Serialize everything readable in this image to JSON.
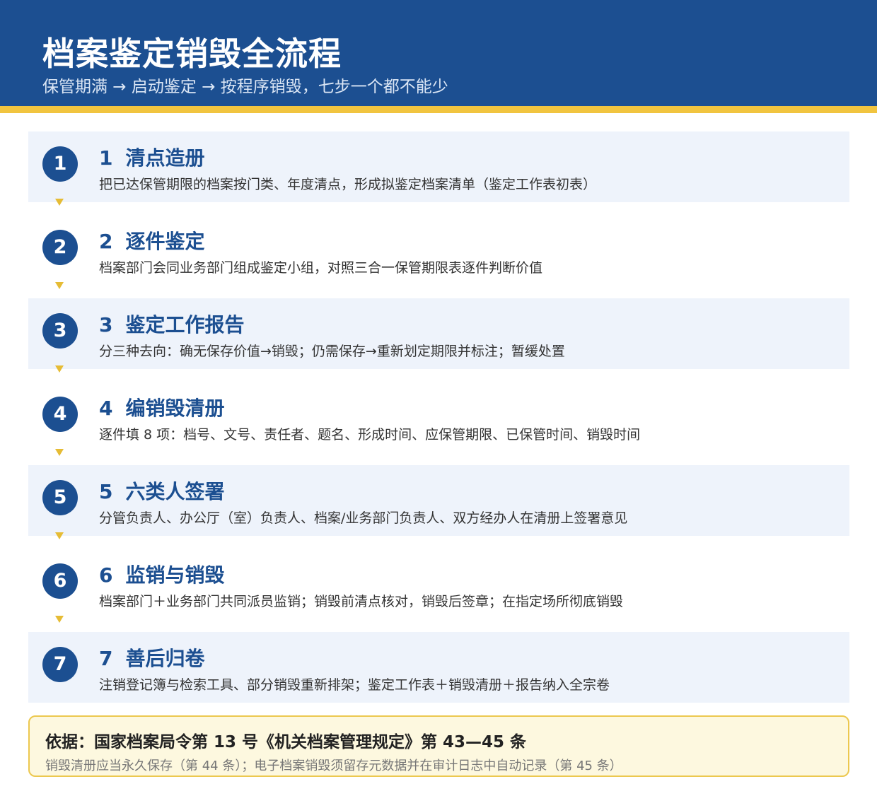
{
  "header": {
    "title": "档案鉴定销毁全流程",
    "subtitle": "保管期满 → 启动鉴定 → 按程序销毁，七步一个都不能少"
  },
  "steps": [
    {
      "num": "1",
      "title": "清点造册",
      "desc": "把已达保管期限的档案按门类、年度清点，形成拟鉴定档案清单（鉴定工作表初表）"
    },
    {
      "num": "2",
      "title": "逐件鉴定",
      "desc": "档案部门会同业务部门组成鉴定小组，对照三合一保管期限表逐件判断价值"
    },
    {
      "num": "3",
      "title": "鉴定工作报告",
      "desc": "分三种去向：确无保存价值→销毁；仍需保存→重新划定期限并标注；暂缓处置"
    },
    {
      "num": "4",
      "title": "编销毁清册",
      "desc": "逐件填 8 项：档号、文号、责任者、题名、形成时间、应保管期限、已保管时间、销毁时间"
    },
    {
      "num": "5",
      "title": "六类人签署",
      "desc": "分管负责人、办公厅（室）负责人、档案/业务部门负责人、双方经办人在清册上签署意见"
    },
    {
      "num": "6",
      "title": "监销与销毁",
      "desc": "档案部门＋业务部门共同派员监销；销毁前清点核对，销毁后签章；在指定场所彻底销毁"
    },
    {
      "num": "7",
      "title": "善后归卷",
      "desc": "注销登记簿与检索工具、部分销毁重新排架；鉴定工作表＋销毁清册＋报告纳入全宗卷"
    }
  ],
  "note": {
    "title": "依据：国家档案局令第 13 号《机关档案管理规定》第 43—45 条",
    "text": "销毁清册应当永久保存（第 44 条）；电子档案销毁须留存元数据并在审计日志中自动记录（第 45 条）"
  },
  "colors": {
    "header_bg": "#1c4f91",
    "header_accent": "#f1c43f",
    "step_bg": "#eef3fb",
    "step_title": "#1c4f91",
    "arrow": "#e6bc35",
    "note_bg": "#fdf8df",
    "note_border": "#ecc84f"
  }
}
